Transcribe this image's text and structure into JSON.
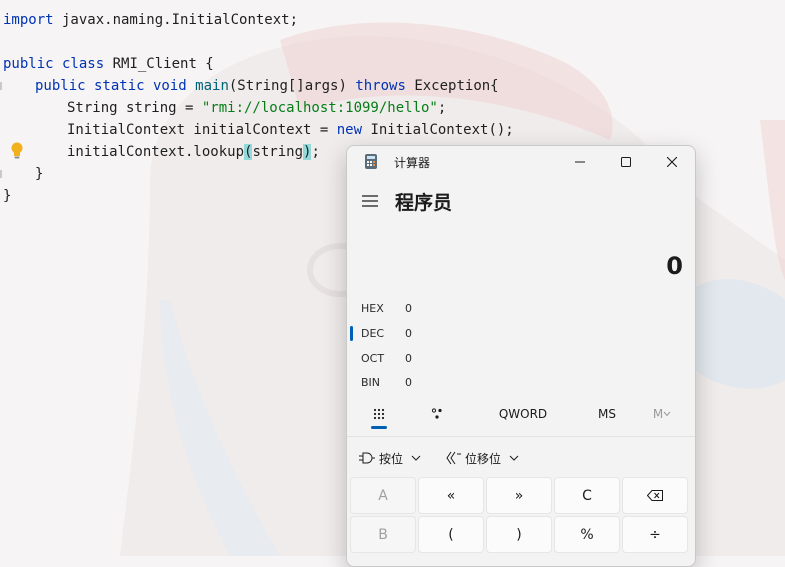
{
  "code": {
    "line1": [
      "import",
      " javax.naming.InitialContext;"
    ],
    "line3_kw": "public class",
    "line3_rest": " RMI_Client {",
    "line4_kw1": "public static void",
    "line4_method": "main",
    "line4_mid": "(String[]args) ",
    "line4_kw2": "throws",
    "line4_rest": " Exception{",
    "line5_type": "String string = ",
    "line5_str": "\"rmi://localhost:1099/hello\"",
    "line5_end": ";",
    "line6_a": "InitialContext initialContext = ",
    "line6_kw": "new",
    "line6_b": " InitialContext();",
    "line7_a": "initialContext.lookup",
    "line7_open": "(",
    "line7_arg": "string",
    "line7_close": ")",
    "line7_end": ";",
    "line8": "}",
    "line9": "}"
  },
  "calculator": {
    "window_title": "计算器",
    "mode": "程序员",
    "display_value": "0",
    "radix": [
      {
        "label": "HEX",
        "value": "0"
      },
      {
        "label": "DEC",
        "value": "0"
      },
      {
        "label": "OCT",
        "value": "0"
      },
      {
        "label": "BIN",
        "value": "0"
      }
    ],
    "selected_radix": "DEC",
    "word_size": "QWORD",
    "memory_store": "MS",
    "memory_menu": "M",
    "bitwise_label": "按位",
    "bitshift_label": "位移位",
    "keys_row1": [
      "A",
      "«",
      "»",
      "C",
      ""
    ],
    "keys_row2": [
      "B",
      "(",
      ")",
      "%",
      "÷"
    ]
  },
  "colors": {
    "accent": "#0060b6",
    "keyword": "#0033b3",
    "string": "#067d17",
    "method": "#00627a"
  }
}
